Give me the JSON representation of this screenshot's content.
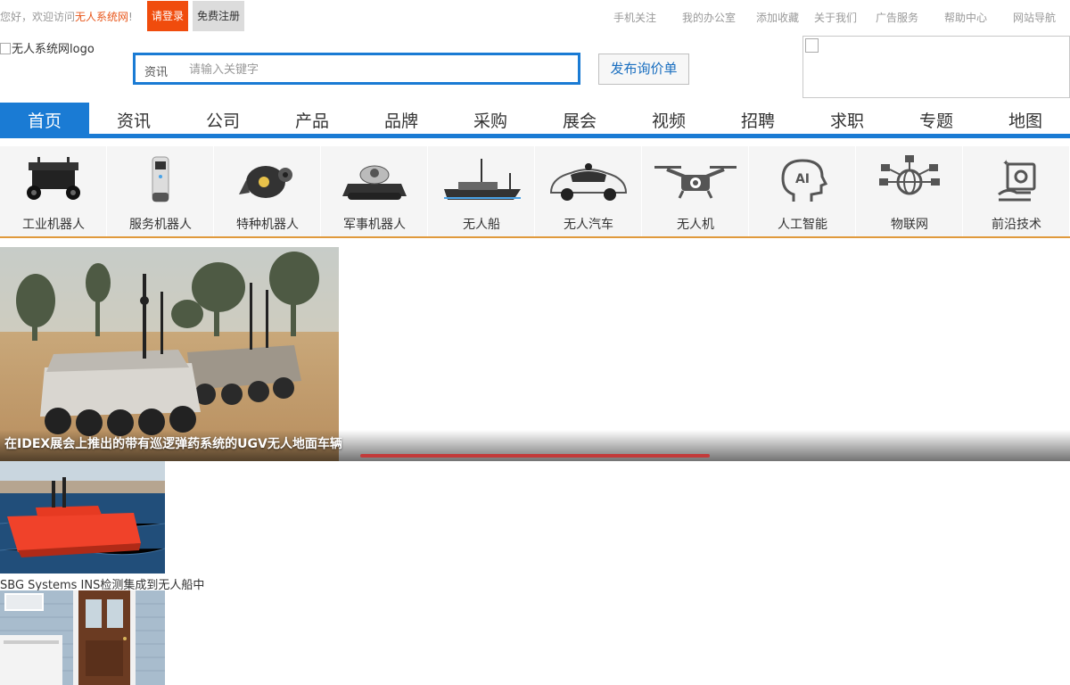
{
  "topbar": {
    "welcome_prefix": "您好，欢迎访问",
    "site_name": "无人系统网",
    "welcome_suffix": "!",
    "login_label": "请登录",
    "register_label": "免费注册",
    "links": [
      "手机关注",
      "我的办公室",
      "添加收藏",
      "关于我们",
      "广告服务",
      "帮助中心",
      "网站导航"
    ]
  },
  "header": {
    "logo_alt": "无人系统网logo",
    "search_category": "资讯",
    "search_placeholder": "请输入关键字",
    "post_button": "发布询价单"
  },
  "nav": {
    "items": [
      "首页",
      "资讯",
      "公司",
      "产品",
      "品牌",
      "采购",
      "展会",
      "视频",
      "招聘",
      "求职",
      "专题",
      "地图"
    ],
    "active_index": 0
  },
  "categories": [
    {
      "label": "工业机器人",
      "icon": "industrial-robot-icon"
    },
    {
      "label": "服务机器人",
      "icon": "service-robot-icon"
    },
    {
      "label": "特种机器人",
      "icon": "special-robot-icon"
    },
    {
      "label": "军事机器人",
      "icon": "military-robot-icon"
    },
    {
      "label": "无人船",
      "icon": "unmanned-boat-icon"
    },
    {
      "label": "无人汽车",
      "icon": "driverless-car-icon"
    },
    {
      "label": "无人机",
      "icon": "drone-icon"
    },
    {
      "label": "人工智能",
      "icon": "ai-head-icon"
    },
    {
      "label": "物联网",
      "icon": "iot-globe-icon"
    },
    {
      "label": "前沿技术",
      "icon": "frontier-tech-icon"
    }
  ],
  "slider": {
    "caption": "在IDEX展会上推出的带有巡逻弹药系统的UGV无人地面车辆"
  },
  "news": [
    {
      "title": "SBG Systems INS检测集成到无人船中"
    }
  ],
  "colors": {
    "brand_blue": "#1a7bd4",
    "login_orange": "#f04c0d",
    "strip_border": "#e09a3c"
  }
}
